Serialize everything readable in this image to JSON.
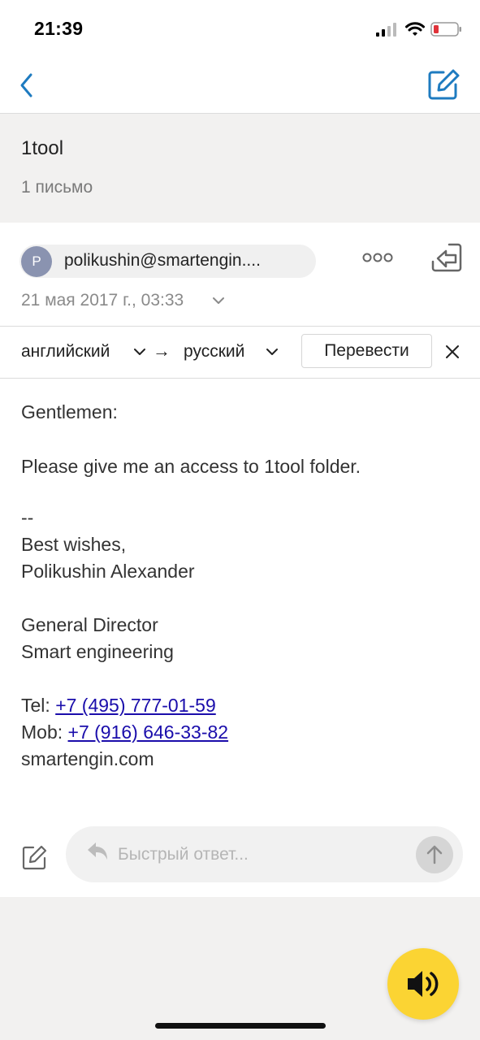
{
  "status_bar": {
    "time": "21:39"
  },
  "thread": {
    "title": "1tool",
    "count": "1 письмо"
  },
  "message": {
    "sender_initial": "P",
    "sender_email": "polikushin@smartengin....",
    "date": "21 мая 2017 г., 03:33"
  },
  "translate": {
    "from": "английский",
    "arrow": "→",
    "to": "русский",
    "button": "Перевести"
  },
  "body": {
    "greeting": "Gentlemen:",
    "text": "Please give me an access to 1tool folder.",
    "sig_dash": "--",
    "wishes": "Best wishes,",
    "name": "Polikushin Alexander",
    "title": "General Director",
    "company": "Smart engineering",
    "tel_label": "Tel: ",
    "tel": "+7 (495) 777-01-59",
    "mob_label": "Mob: ",
    "mob": "+7 (916) 646-33-82",
    "site": "smartengin.com"
  },
  "quick_reply": {
    "placeholder": "Быстрый ответ..."
  },
  "colors": {
    "accent": "#1e7bc0",
    "link": "#1a0dab",
    "fab": "#fbd433",
    "battery_low": "#e0333a"
  },
  "icons": [
    "back-icon",
    "compose-icon",
    "more-icon",
    "reply-icon",
    "chevron-down-icon",
    "close-icon",
    "edit-icon",
    "reply-arrow-icon",
    "send-arrow-icon",
    "speaker-icon",
    "signal-icon",
    "wifi-icon",
    "battery-icon"
  ]
}
